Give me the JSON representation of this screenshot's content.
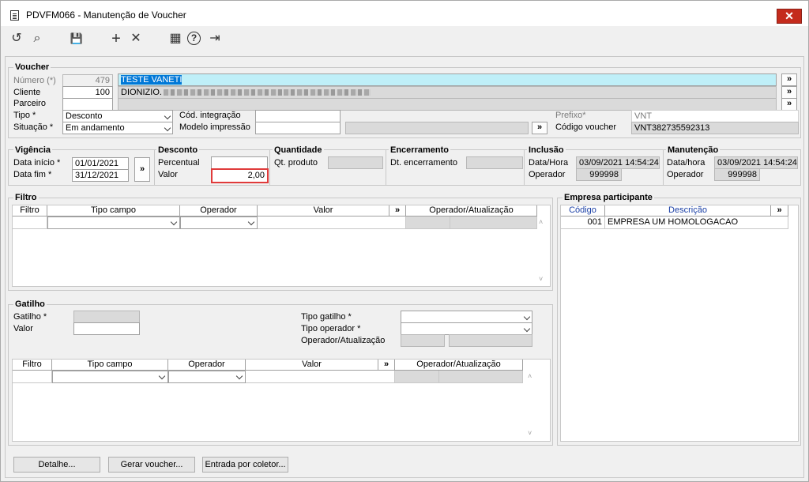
{
  "window": {
    "title": "PDVFM066 - Manutenção de Voucher",
    "close_label": "✕"
  },
  "toolbar": {
    "undo": "↺",
    "search": "⌕",
    "save": "💾",
    "add": "+",
    "delete": "✕",
    "calendar": "▦",
    "help": "?",
    "exit": "⇥"
  },
  "voucher": {
    "title": "Voucher",
    "numero_label": "Número (*)",
    "numero_value": "479",
    "numero_desc": "TESTE VANETI",
    "cliente_label": "Cliente",
    "cliente_value": "100",
    "cliente_desc": "DIONIZIO.",
    "parceiro_label": "Parceiro",
    "parceiro_value": "",
    "tipo_label": "Tipo *",
    "tipo_value": "Desconto",
    "situacao_label": "Situação *",
    "situacao_value": "Em andamento",
    "cod_integracao_label": "Cód. integração",
    "cod_integracao_value": "",
    "modelo_impressao_label": "Modelo impressão",
    "modelo_impressao_value": "",
    "prefixo_label": "Prefixo*",
    "prefixo_value": "VNT",
    "codigo_voucher_label": "Código voucher",
    "codigo_voucher_value": "VNT382735592313",
    "more": "»"
  },
  "vigencia": {
    "title": "Vigência",
    "inicio_label": "Data início *",
    "inicio_value": "01/01/2021",
    "fim_label": "Data fim *",
    "fim_value": "31/12/2021",
    "more": "»"
  },
  "desconto": {
    "title": "Desconto",
    "percentual_label": "Percentual",
    "percentual_value": "",
    "valor_label": "Valor",
    "valor_value": "2,00"
  },
  "quantidade": {
    "title": "Quantidade",
    "qt_label": "Qt. produto",
    "qt_value": ""
  },
  "encerramento": {
    "title": "Encerramento",
    "dt_label": "Dt. encerramento",
    "dt_value": ""
  },
  "inclusao": {
    "title": "Inclusão",
    "dh_label": "Data/Hora",
    "dh_value": "03/09/2021 14:54:24",
    "op_label": "Operador",
    "op_value": "999998"
  },
  "manutencao": {
    "title": "Manutenção",
    "dh_label": "Data/hora",
    "dh_value": "03/09/2021 14:54:24",
    "op_label": "Operador",
    "op_value": "999998"
  },
  "filtro": {
    "title": "Filtro",
    "columns": [
      "Filtro",
      "Tipo campo",
      "Operador",
      "Valor",
      "»",
      "Operador/Atualização"
    ]
  },
  "empresa": {
    "title": "Empresa participante",
    "columns": [
      "Código",
      "Descrição",
      "»"
    ],
    "rows": [
      {
        "codigo": "001",
        "descricao": "EMPRESA UM HOMOLOGACAO"
      }
    ],
    "accent": "#1a3fa6"
  },
  "gatilho": {
    "title": "Gatilho",
    "gatilho_label": "Gatilho *",
    "gatilho_value": "",
    "valor_label": "Valor",
    "valor_value": "",
    "tipo_gatilho_label": "Tipo gatilho *",
    "tipo_gatilho_value": "",
    "tipo_operador_label": "Tipo operador *",
    "tipo_operador_value": "",
    "op_atual_label": "Operador/Atualização",
    "columns": [
      "Filtro",
      "Tipo campo",
      "Operador",
      "Valor",
      "»",
      "Operador/Atualização"
    ]
  },
  "buttons": {
    "detalhe": "Detalhe...",
    "gerar": "Gerar voucher...",
    "entrada": "Entrada por coletor..."
  },
  "scroll": {
    "up": "˄",
    "down": "˅"
  }
}
